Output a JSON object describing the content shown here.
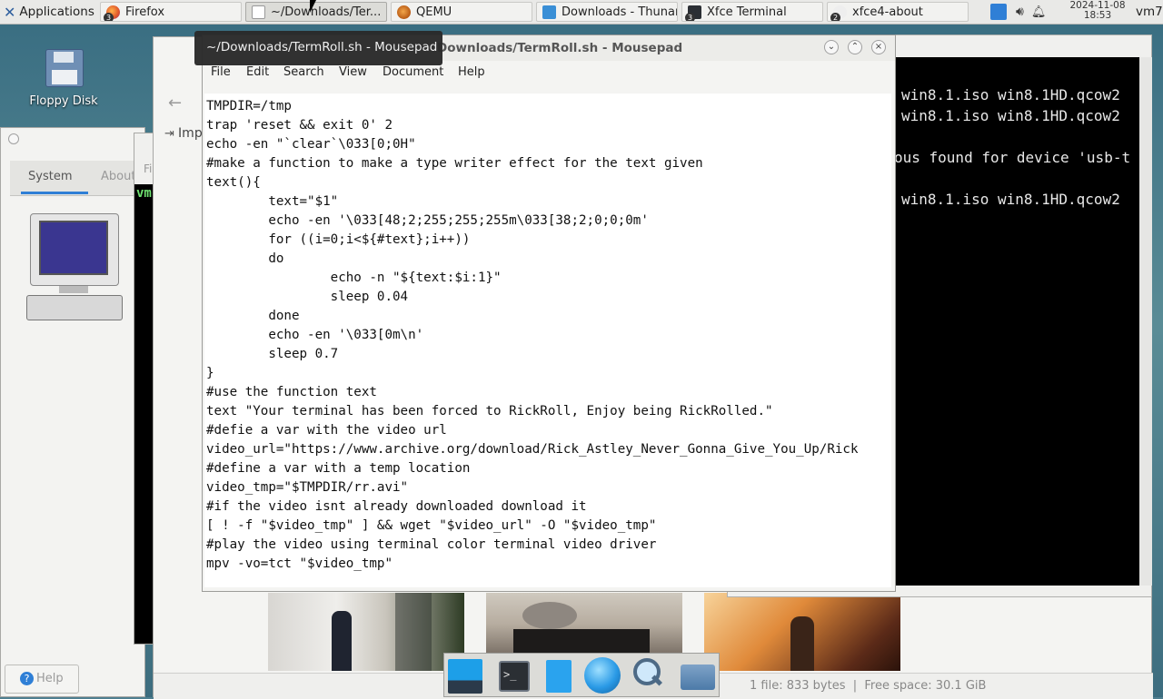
{
  "panel": {
    "applications_label": "Applications",
    "tasks": [
      {
        "label": "Firefox",
        "badge": "3"
      },
      {
        "label": "~/Downloads/Ter...",
        "badge": ""
      },
      {
        "label": "QEMU",
        "badge": ""
      },
      {
        "label": "Downloads - Thunar",
        "badge": ""
      },
      {
        "label": "Xfce Terminal",
        "badge": "3"
      },
      {
        "label": "xfce4-about",
        "badge": "2"
      }
    ],
    "date": "2024-11-08",
    "time": "18:53",
    "user": "vm7"
  },
  "desktop": {
    "floppy_label": "Floppy Disk"
  },
  "about": {
    "tab_system": "System",
    "tab_about": "About",
    "help_label": "Help"
  },
  "thunar": {
    "import_label": "Imp",
    "status": "1 file: 833 bytes  |  Free space: 30.1 GiB"
  },
  "terminal": {
    "prompt_fragment": "vm",
    "lines": [
      "win8.1.iso win8.1HD.qcow2",
      "win8.1.iso win8.1HD.qcow2",
      "ous found for device 'usb-t",
      "win8.1.iso win8.1HD.qcow2"
    ]
  },
  "mousepad": {
    "title": "~/Downloads/TermRoll.sh - Mousepad",
    "title_partial": "Downloads/TermRoll.sh - Mousepad",
    "tooltip": "~/Downloads/TermRoll.sh - Mousepad",
    "menu": [
      "File",
      "Edit",
      "Search",
      "View",
      "Document",
      "Help"
    ],
    "lines": [
      "TMPDIR=/tmp",
      "trap 'reset && exit 0' 2",
      "echo -en \"`clear`\\033[0;0H\"",
      "#make a function to make a type writer effect for the text given",
      "text(){",
      "        text=\"$1\"",
      "        echo -en '\\033[48;2;255;255;255m\\033[38;2;0;0;0m'",
      "        for ((i=0;i<${#text};i++))",
      "        do",
      "                echo -n \"${text:$i:1}\"",
      "                sleep 0.04",
      "        done",
      "        echo -en '\\033[0m\\n'",
      "        sleep 0.7",
      "}",
      "#use the function text",
      "text \"Your terminal has been forced to RickRoll, Enjoy being RickRolled.\"",
      "#defie a var with the video url",
      "video_url=\"https://www.archive.org/download/Rick_Astley_Never_Gonna_Give_You_Up/Rick",
      "#define a var with a temp location",
      "video_tmp=\"$TMPDIR/rr.avi\"",
      "#if the video isnt already downloaded download it",
      "[ ! -f \"$video_tmp\" ] && wget \"$video_url\" -O \"$video_tmp\"",
      "#play the video using terminal color terminal video driver",
      "mpv -vo=tct \"$video_tmp\""
    ]
  },
  "colors": {
    "panel_bg": "#e9e9e7",
    "accent_blue": "#2f7fd6",
    "terminal_bg": "#000000",
    "prompt_green": "#6fe070"
  }
}
